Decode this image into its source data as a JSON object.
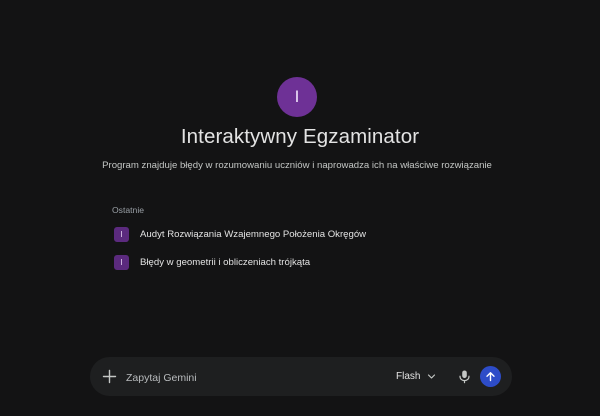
{
  "gem": {
    "avatar_letter": "I",
    "title": "Interaktywny Egzaminator",
    "description": "Program znajduje błędy w rozumowaniu uczniów i naprowadza ich na właściwe rozwiązanie"
  },
  "recent": {
    "heading": "Ostatnie",
    "items": [
      {
        "letter": "I",
        "label": "Audyt Rozwiązania Wzajemnego Położenia Okręgów"
      },
      {
        "letter": "I",
        "label": "Błędy w geometrii i obliczeniach trójkąta"
      }
    ]
  },
  "composer": {
    "placeholder": "Zapytaj Gemini",
    "value": "",
    "model_label": "Flash",
    "icons": {
      "add": "plus-icon",
      "model_dropdown": "chevron-down-icon",
      "voice": "microphone-icon",
      "send": "arrow-up-icon"
    }
  },
  "colors": {
    "background": "#131314",
    "avatar": "#6e3196",
    "composer": "#1e1f20",
    "send_button": "#2d4cc8"
  }
}
